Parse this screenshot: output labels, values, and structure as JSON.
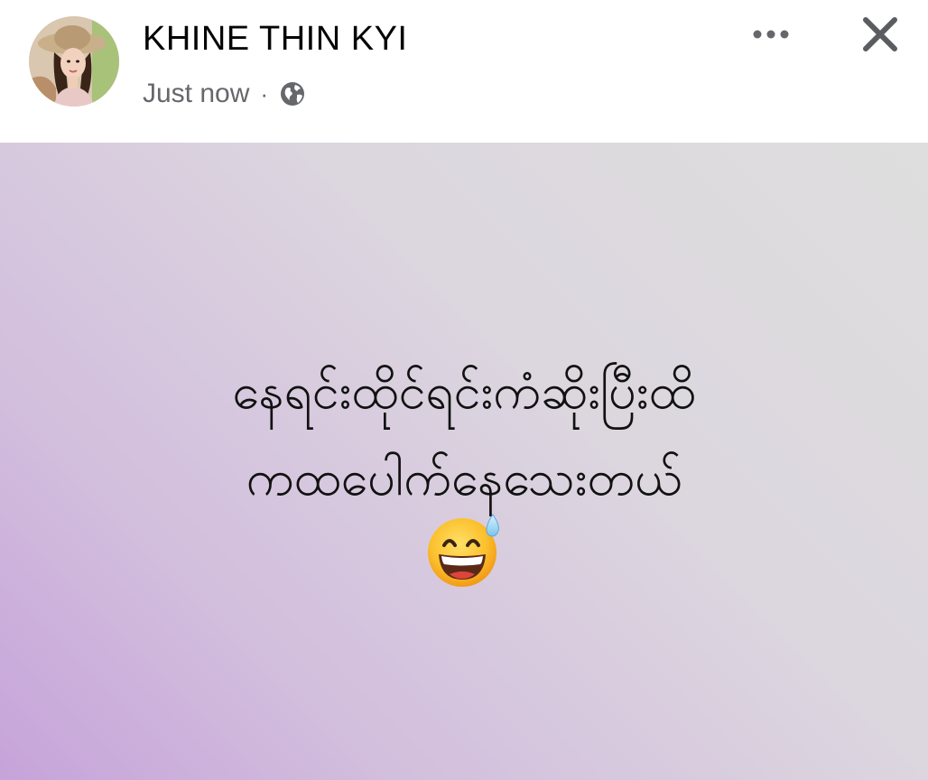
{
  "post": {
    "author": {
      "name": "KHINE THIN KYI"
    },
    "timestamp": "Just now",
    "separator": "·",
    "privacy_icon": "globe-icon",
    "actions": {
      "more_icon": "more-horizontal-icon",
      "close_icon": "close-icon"
    },
    "content": {
      "line1": "နေရင်းထိုင်ရင်းကံဆိုးပြီးထိ",
      "line2": "ကထပေါက်နေသေးတယ်",
      "emoji_icon": "grinning-face-with-sweat-icon"
    },
    "background_colors": {
      "top_right": "#dedede",
      "bottom_left": "#c6a3da"
    }
  }
}
